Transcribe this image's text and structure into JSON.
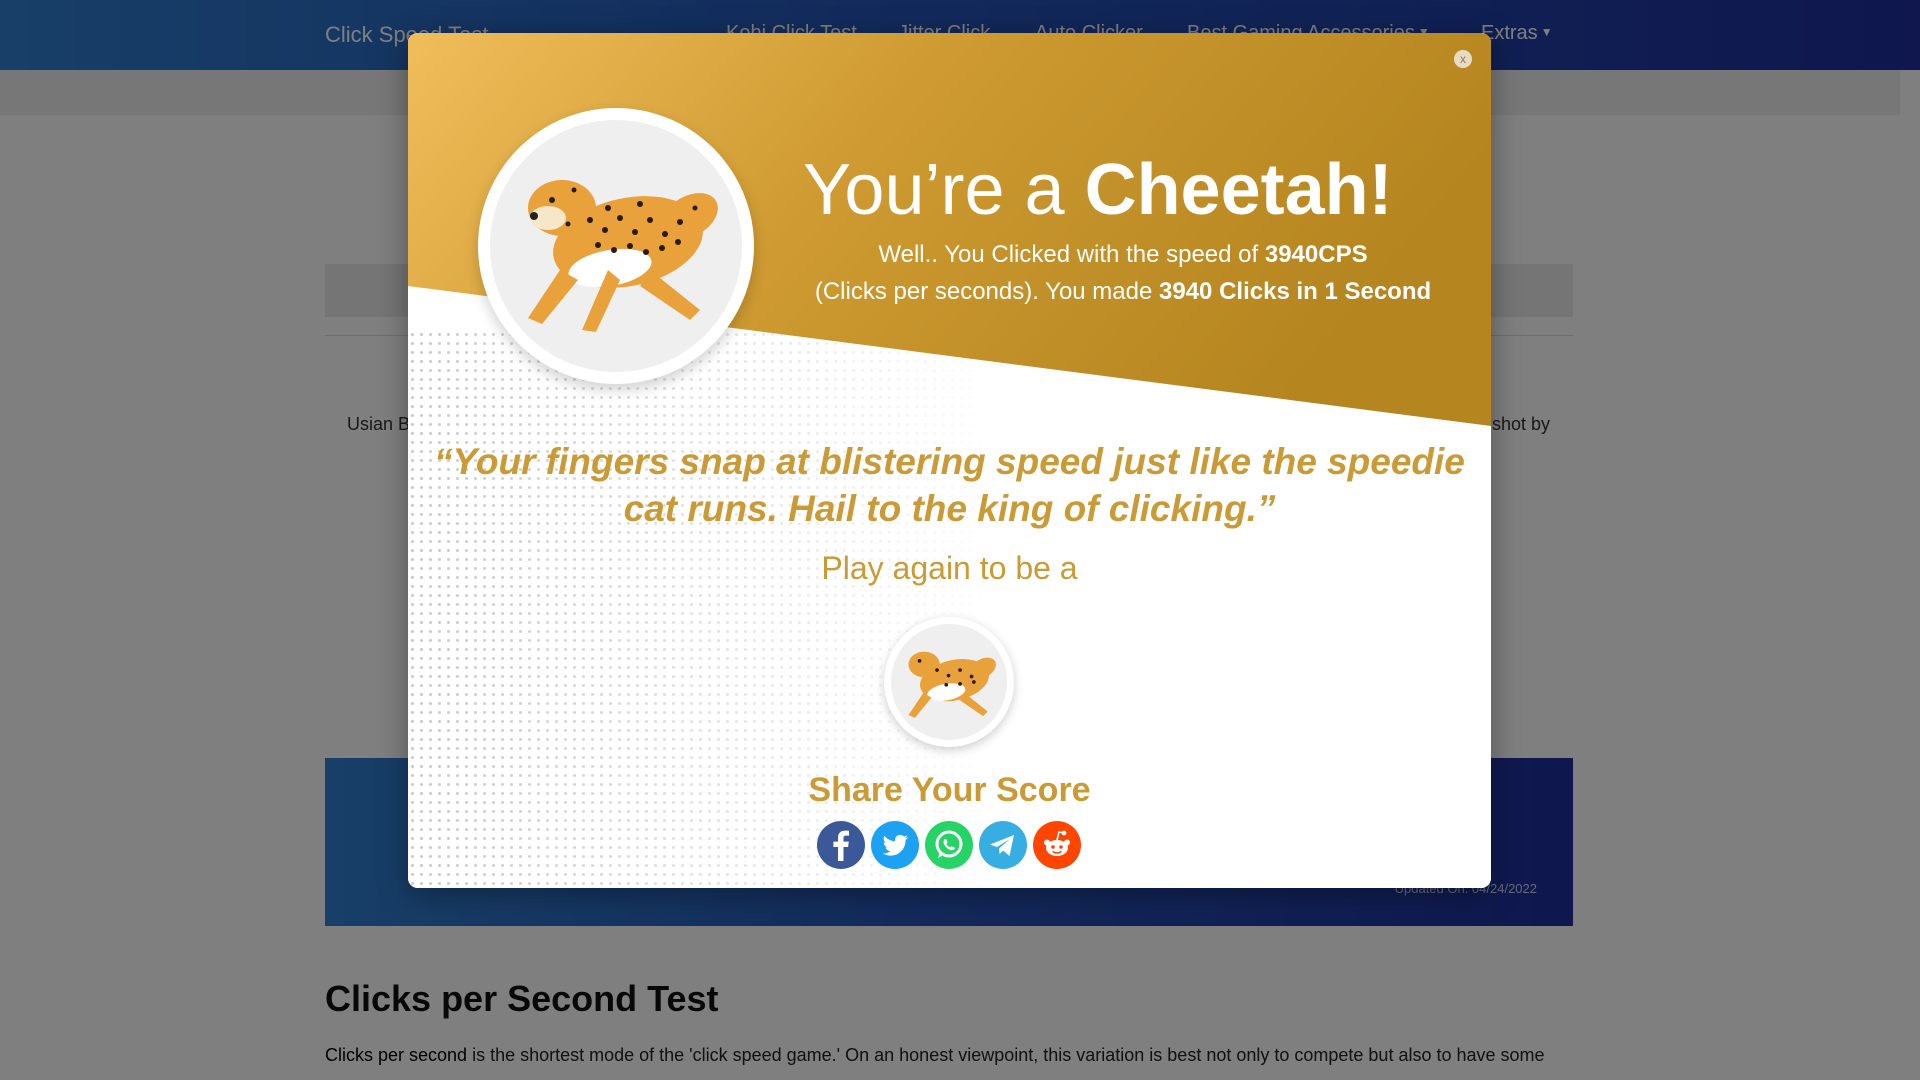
{
  "navbar": {
    "brand": "Click Speed Test",
    "items": [
      {
        "label": "Kohi Click Test"
      },
      {
        "label": "Jitter Click"
      },
      {
        "label": "Auto Clicker"
      },
      {
        "label": "Best Gaming Accessories",
        "dropdown": true
      },
      {
        "label": "Extras",
        "dropdown": true
      }
    ]
  },
  "page": {
    "peek_left_text": "Usian Bo",
    "peek_right_text": "shot by",
    "updated_text": "Updated On: 04/24/2022",
    "section_title": "Clicks per Second Test",
    "section_lead": "Clicks per second",
    "section_text": " is the shortest mode of the 'click speed game.' On an honest viewpoint, this variation is best not only to compete but also to have some"
  },
  "modal": {
    "close_label": "x",
    "headline_prefix": "You’re a ",
    "headline_animal": "Cheetah!",
    "line1_prefix": "Well.. You Clicked with the speed of ",
    "line1_value": "3940CPS",
    "line2_prefix": "(Clicks per seconds). You made ",
    "line2_value": "3940 Clicks in 1 Second",
    "quote": "“Your fingers snap at blistering speed just like the speedie cat runs. Hail to the king of clicking.”",
    "play_again": "Play again to be a",
    "share_title": "Share Your Score",
    "share_buttons": [
      {
        "name": "facebook",
        "icon": "facebook-icon",
        "color": "#3b5998"
      },
      {
        "name": "twitter",
        "icon": "twitter-icon",
        "color": "#1da1f2"
      },
      {
        "name": "whatsapp",
        "icon": "whatsapp-icon",
        "color": "#25d366"
      },
      {
        "name": "telegram",
        "icon": "telegram-icon",
        "color": "#37aee2"
      },
      {
        "name": "reddit",
        "icon": "reddit-icon",
        "color": "#ff4500"
      }
    ]
  },
  "colors": {
    "gold": "#c99a35",
    "nav_start": "#2f7fd0",
    "nav_end": "#1e2f9c"
  }
}
